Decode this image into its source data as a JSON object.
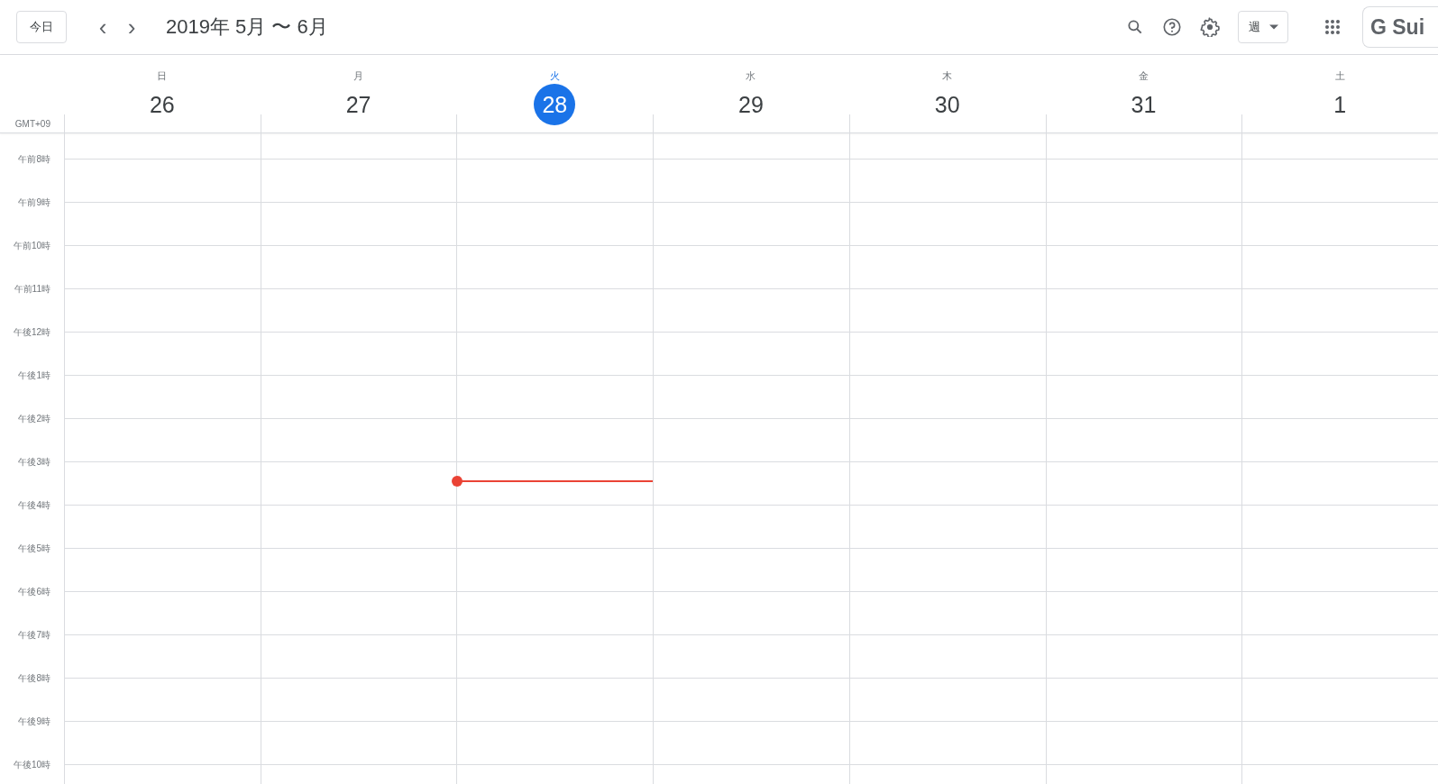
{
  "toolbar": {
    "today_button": "今日",
    "prev": "‹",
    "next": "›",
    "title": "2019年 5月 〜 6月",
    "view_button": "週",
    "brand": "G Sui"
  },
  "timezone": "GMT+09",
  "days": [
    {
      "weekday": "日",
      "date": "26",
      "today": false
    },
    {
      "weekday": "月",
      "date": "27",
      "today": false
    },
    {
      "weekday": "火",
      "date": "28",
      "today": true
    },
    {
      "weekday": "水",
      "date": "29",
      "today": false
    },
    {
      "weekday": "木",
      "date": "30",
      "today": false
    },
    {
      "weekday": "金",
      "date": "31",
      "today": false
    },
    {
      "weekday": "土",
      "date": "1",
      "today": false
    }
  ],
  "hours": [
    {
      "label": "午前8時",
      "now": false
    },
    {
      "label": "午前9時",
      "now": false
    },
    {
      "label": "午前10時",
      "now": false
    },
    {
      "label": "午前11時",
      "now": false
    },
    {
      "label": "午後12時",
      "now": false
    },
    {
      "label": "午後1時",
      "now": false
    },
    {
      "label": "午後2時",
      "now": false
    },
    {
      "label": "午後3時",
      "now": true
    },
    {
      "label": "午後4時",
      "now": false
    },
    {
      "label": "午後5時",
      "now": false
    },
    {
      "label": "午後6時",
      "now": false
    },
    {
      "label": "午後7時",
      "now": false
    },
    {
      "label": "午後8時",
      "now": false
    },
    {
      "label": "午後9時",
      "now": false
    },
    {
      "label": "午後10時",
      "now": false
    }
  ]
}
